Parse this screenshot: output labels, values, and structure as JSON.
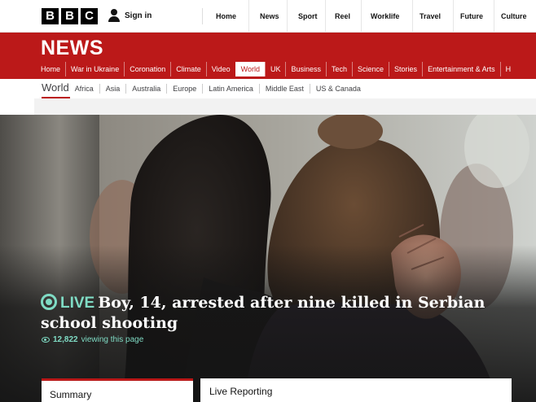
{
  "header": {
    "logo": [
      "B",
      "B",
      "C"
    ],
    "sign_in": "Sign in",
    "nav": [
      "Home",
      "News",
      "Sport",
      "Reel",
      "Worklife",
      "Travel",
      "Future",
      "Culture"
    ]
  },
  "news": {
    "title": "NEWS",
    "nav": [
      "Home",
      "War in Ukraine",
      "Coronation",
      "Climate",
      "Video",
      "World",
      "UK",
      "Business",
      "Tech",
      "Science",
      "Stories",
      "Entertainment & Arts",
      "H"
    ],
    "active": "World"
  },
  "world_nav": {
    "current": "World",
    "items": [
      "Africa",
      "Asia",
      "Australia",
      "Europe",
      "Latin America",
      "Middle East",
      "US & Canada"
    ]
  },
  "story": {
    "live_label": "LIVE",
    "headline": "Boy, 14, arrested after nine killed in Serbian school shooting",
    "viewer_count": "12,822",
    "viewer_suffix": "viewing this page"
  },
  "tabs": {
    "summary": "Summary",
    "live_reporting": "Live Reporting"
  },
  "colors": {
    "news_red": "#bb1919",
    "live_green": "#7fdbc4"
  }
}
